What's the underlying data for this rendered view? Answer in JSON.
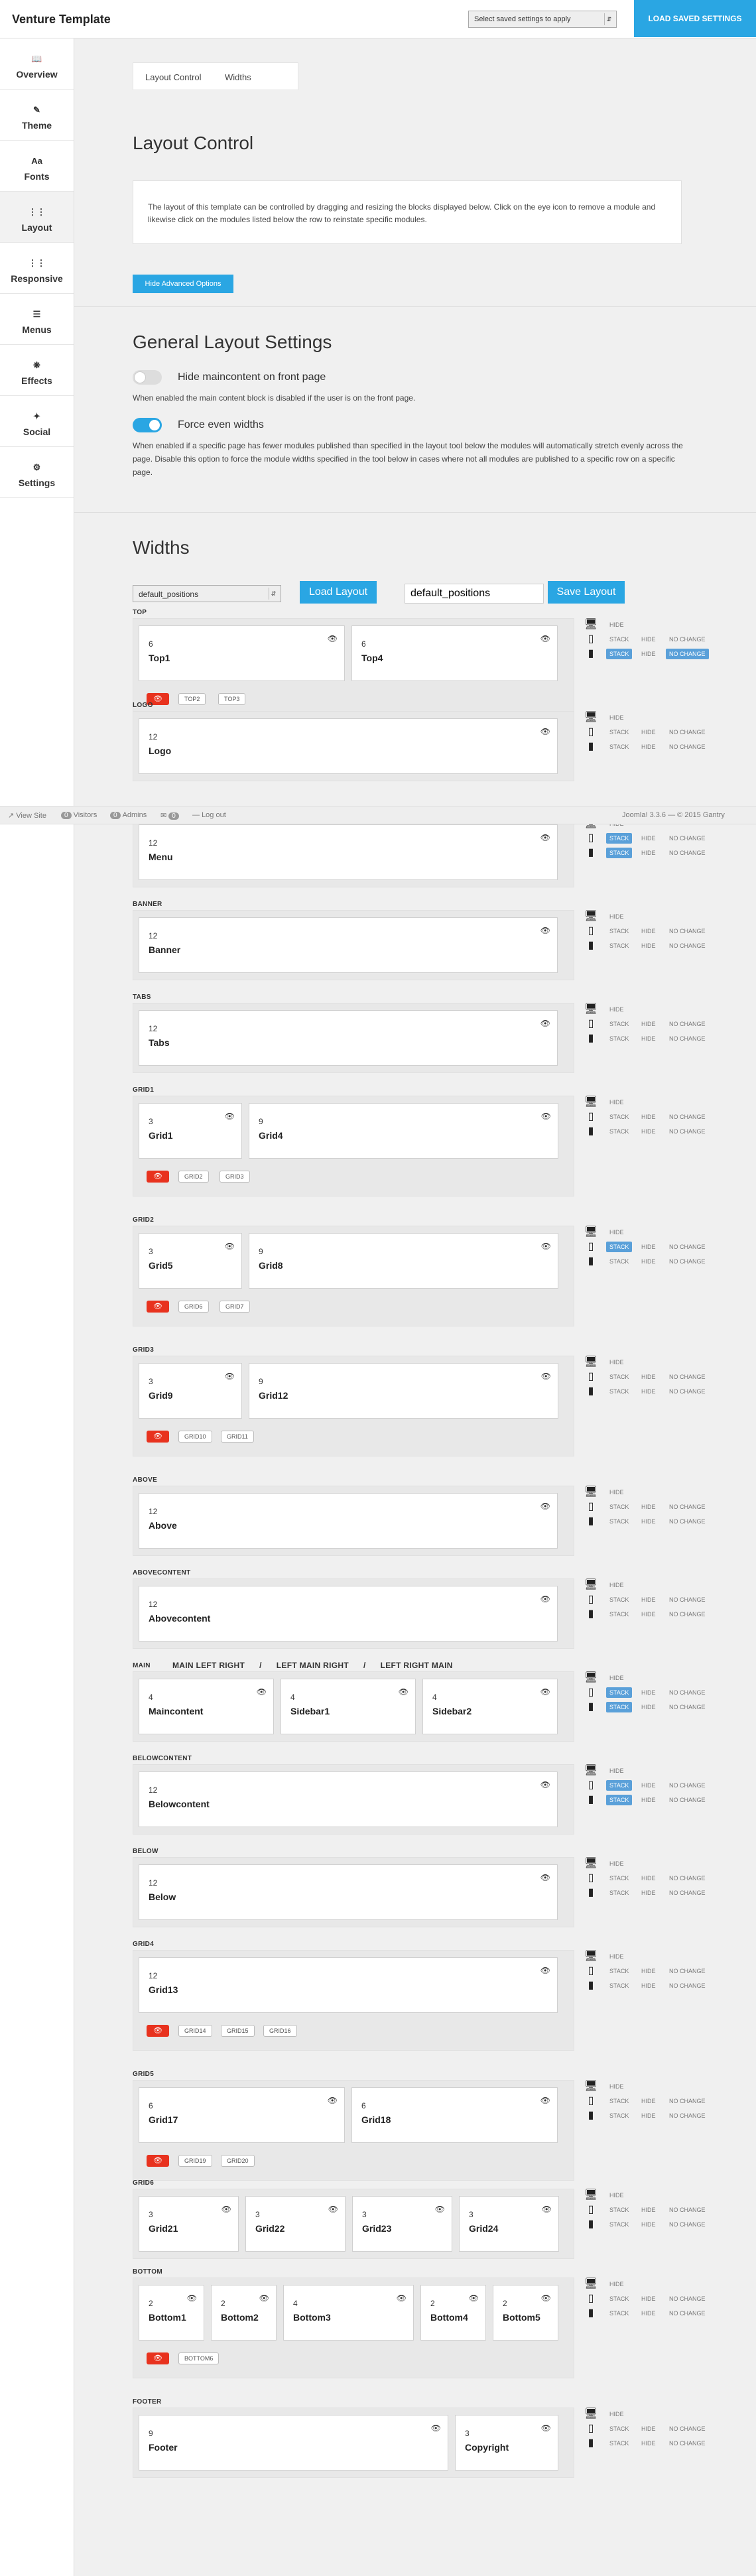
{
  "header": {
    "title": "Venture Template",
    "preset_select": "Select saved settings to apply",
    "load_button": "LOAD SAVED SETTINGS"
  },
  "sidebar": {
    "items": [
      {
        "icon": "book-icon",
        "label": "Overview",
        "active": false
      },
      {
        "icon": "brush-icon",
        "label": "Theme",
        "active": false
      },
      {
        "icon": "font-icon",
        "label": "Fonts",
        "active": false
      },
      {
        "icon": "grid-icon",
        "label": "Layout",
        "active": true
      },
      {
        "icon": "responsive-grid-icon",
        "label": "Responsive",
        "active": false
      },
      {
        "icon": "menu-icon",
        "label": "Menus",
        "active": false
      },
      {
        "icon": "effects-icon",
        "label": "Effects",
        "active": false
      },
      {
        "icon": "twitter-icon",
        "label": "Social",
        "active": false
      },
      {
        "icon": "gear-icon",
        "label": "Settings",
        "active": false
      }
    ]
  },
  "tabs": [
    "Layout Control",
    "Widths"
  ],
  "layout_control": {
    "title": "Layout Control",
    "description": "The layout of this template can be controlled by dragging and resizing the blocks displayed below. Click on the eye icon to remove a module and likewise click on the modules listed below the row to reinstate specific modules.",
    "hide_advanced": "Hide Advanced Options"
  },
  "general": {
    "title": "General Layout Settings",
    "hide_main_label": "Hide maincontent on front page",
    "hide_main_on": false,
    "hide_main_desc": "When enabled the main content block is disabled if the user is on the front page.",
    "force_even_label": "Force even widths",
    "force_even_on": true,
    "force_even_desc": "When enabled if a specific page has fewer modules published than specified in the layout tool below the modules will automatically stretch evenly across the page. Disable this option to force the module widths specified in the tool below in cases where not all modules are published to a specific row on a specific page."
  },
  "widths": {
    "title": "Widths",
    "select_value": "default_positions",
    "load_label": "Load Layout",
    "layout_name": "default_positions",
    "save_label": "Save Layout"
  },
  "device_labels": {
    "hide": "HIDE",
    "stack": "STACK",
    "no_change": "NO CHANGE"
  },
  "main_options": [
    "MAIN LEFT RIGHT",
    "/",
    "LEFT MAIN RIGHT",
    "/",
    "LEFT RIGHT MAIN"
  ],
  "sections": [
    {
      "name": "TOP",
      "blocks": [
        {
          "w": "6",
          "n": "Top1"
        },
        {
          "w": "6",
          "n": "Top4"
        }
      ],
      "hidden": [
        "TOP2",
        "TOP3"
      ],
      "tablet": "none",
      "phone": "stack-nochange"
    },
    {
      "name": "LOGO",
      "blocks": [
        {
          "w": "12",
          "n": "Logo"
        }
      ],
      "hidden": [],
      "tablet": "none",
      "phone": "none"
    },
    {
      "name": "MENU",
      "blocks": [
        {
          "w": "12",
          "n": "Menu"
        }
      ],
      "hidden": [],
      "tablet": "stack",
      "phone": "stack"
    },
    {
      "name": "BANNER",
      "blocks": [
        {
          "w": "12",
          "n": "Banner"
        }
      ],
      "hidden": [],
      "tablet": "none",
      "phone": "none"
    },
    {
      "name": "TABS",
      "blocks": [
        {
          "w": "12",
          "n": "Tabs"
        }
      ],
      "hidden": [],
      "tablet": "none",
      "phone": "none"
    },
    {
      "name": "GRID1",
      "blocks": [
        {
          "w": "3",
          "n": "Grid1"
        },
        {
          "w": "9",
          "n": "Grid4"
        }
      ],
      "hidden": [
        "GRID2",
        "GRID3"
      ],
      "tablet": "none",
      "phone": "none"
    },
    {
      "name": "GRID2",
      "blocks": [
        {
          "w": "3",
          "n": "Grid5"
        },
        {
          "w": "9",
          "n": "Grid8"
        }
      ],
      "hidden": [
        "GRID6",
        "GRID7"
      ],
      "tablet": "stack",
      "phone": "none"
    },
    {
      "name": "GRID3",
      "blocks": [
        {
          "w": "3",
          "n": "Grid9"
        },
        {
          "w": "9",
          "n": "Grid12"
        }
      ],
      "hidden": [
        "GRID10",
        "GRID11"
      ],
      "tablet": "none",
      "phone": "none"
    },
    {
      "name": "ABOVE",
      "blocks": [
        {
          "w": "12",
          "n": "Above"
        }
      ],
      "hidden": [],
      "tablet": "none",
      "phone": "none"
    },
    {
      "name": "ABOVECONTENT",
      "blocks": [
        {
          "w": "12",
          "n": "Abovecontent"
        }
      ],
      "hidden": [],
      "tablet": "none",
      "phone": "none"
    },
    {
      "name": "MAIN",
      "blocks": [
        {
          "w": "4",
          "n": "Maincontent"
        },
        {
          "w": "4",
          "n": "Sidebar1"
        },
        {
          "w": "4",
          "n": "Sidebar2"
        }
      ],
      "hidden": [],
      "tablet": "stack",
      "phone": "stack"
    },
    {
      "name": "BELOWCONTENT",
      "blocks": [
        {
          "w": "12",
          "n": "Belowcontent"
        }
      ],
      "hidden": [],
      "tablet": "stack",
      "phone": "stack"
    },
    {
      "name": "BELOW",
      "blocks": [
        {
          "w": "12",
          "n": "Below"
        }
      ],
      "hidden": [],
      "tablet": "none",
      "phone": "none"
    },
    {
      "name": "GRID4",
      "blocks": [
        {
          "w": "12",
          "n": "Grid13"
        }
      ],
      "hidden": [
        "GRID14",
        "GRID15",
        "GRID16"
      ],
      "tablet": "none",
      "phone": "none"
    },
    {
      "name": "GRID5",
      "blocks": [
        {
          "w": "6",
          "n": "Grid17"
        },
        {
          "w": "6",
          "n": "Grid18"
        }
      ],
      "hidden": [
        "GRID19",
        "GRID20"
      ],
      "tablet": "none",
      "phone": "none"
    },
    {
      "name": "GRID6",
      "blocks": [
        {
          "w": "3",
          "n": "Grid21"
        },
        {
          "w": "3",
          "n": "Grid22"
        },
        {
          "w": "3",
          "n": "Grid23"
        },
        {
          "w": "3",
          "n": "Grid24"
        }
      ],
      "hidden": [],
      "tablet": "none",
      "phone": "none"
    },
    {
      "name": "BOTTOM",
      "blocks": [
        {
          "w": "2",
          "n": "Bottom1"
        },
        {
          "w": "2",
          "n": "Bottom2"
        },
        {
          "w": "4",
          "n": "Bottom3"
        },
        {
          "w": "2",
          "n": "Bottom4"
        },
        {
          "w": "2",
          "n": "Bottom5"
        }
      ],
      "hidden": [
        "BOTTOM6"
      ],
      "tablet": "none",
      "phone": "none"
    },
    {
      "name": "FOOTER",
      "blocks": [
        {
          "w": "9",
          "n": "Footer"
        },
        {
          "w": "3",
          "n": "Copyright"
        }
      ],
      "hidden": [],
      "tablet": "none",
      "phone": "none"
    }
  ],
  "statusbar": {
    "view_site": "View Site",
    "visitors_count": "0",
    "visitors": "Visitors",
    "admins_count": "0",
    "admins": "Admins",
    "messages_count": "0",
    "logout": "Log out",
    "version": "Joomla! 3.3.6 — © 2015 Gantry"
  },
  "colors": {
    "accent": "#2aa6e3",
    "eye_red": "#e8321e",
    "stack_blue": "#5aa0d9"
  }
}
